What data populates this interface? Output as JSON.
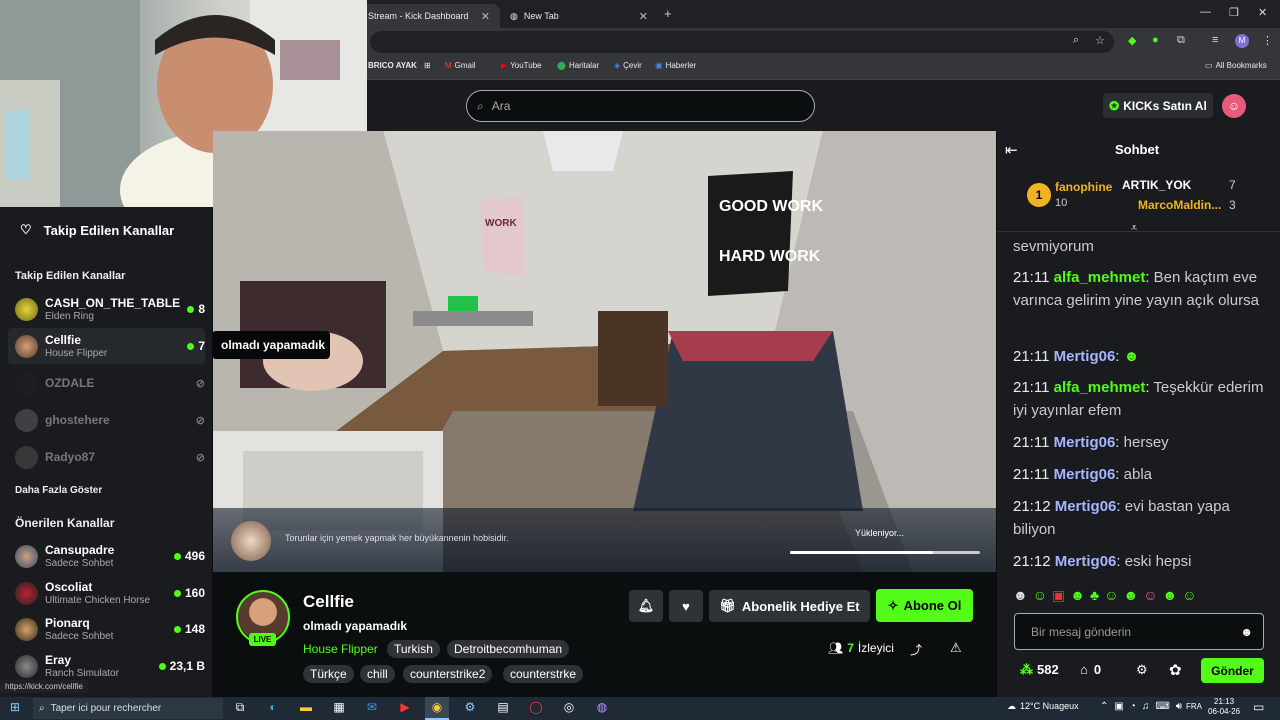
{
  "browser": {
    "tabs": [
      {
        "label": "Stream - Kick Dashboard"
      },
      {
        "label": "New Tab"
      }
    ],
    "bookmarks": [
      {
        "label": "BRICO AYAK"
      },
      {
        "label": "Gmail"
      },
      {
        "label": "YouTube"
      },
      {
        "label": "Haritalar"
      },
      {
        "label": "Çevir"
      },
      {
        "label": "Haberler"
      }
    ],
    "all_bookmarks": "All Bookmarks",
    "profile_initial": "M",
    "status_url": "https://kick.com/cellfie"
  },
  "header": {
    "search_placeholder": "Ara",
    "kicks_button": "KICKs Satın Al"
  },
  "sidebar": {
    "title": "Takip Edilen Kanallar",
    "followed_heading": "Takip Edilen Kanallar",
    "followed": [
      {
        "name": "CASH_ON_THE_TABLE",
        "game": "Elden Ring",
        "viewers": "8",
        "live": true
      },
      {
        "name": "Cellfie",
        "game": "House Flipper",
        "viewers": "7",
        "live": true
      },
      {
        "name": "OZDALE",
        "game": "",
        "viewers": "",
        "live": false
      },
      {
        "name": "ghostehere",
        "game": "",
        "viewers": "",
        "live": false
      },
      {
        "name": "Radyo87",
        "game": "",
        "viewers": "",
        "live": false
      }
    ],
    "show_more": "Daha Fazla Göster",
    "recommended_heading": "Önerilen Kanallar",
    "recommended": [
      {
        "name": "Cansupadre",
        "game": "Sadece Sohbet",
        "viewers": "496"
      },
      {
        "name": "Oscoliat",
        "game": "Ultimate Chicken Horse",
        "viewers": "160"
      },
      {
        "name": "Pionarq",
        "game": "Sadece Sohbet",
        "viewers": "148"
      },
      {
        "name": "Eray",
        "game": "Ranch Simulator",
        "viewers": "23,1 B"
      }
    ],
    "tooltip": "olmadı yapamadık"
  },
  "video": {
    "poster_top": "GOOD WORK",
    "poster_bottom": "HARD WORK",
    "poster_left": "WORK",
    "loading_tip": "Torunlar için yemek yapmak her büyükannenin hobisidir.",
    "loading_label": "Yükleniyor...",
    "loading_progress": 0.75
  },
  "stream_info": {
    "channel": "Cellfie",
    "live_badge": "LIVE",
    "title": "olmadı yapamadık",
    "category": "House Flipper",
    "tags_row1": [
      "Turkish",
      "Detroitbecomhuman"
    ],
    "tags_row2": [
      "Türkçe",
      "chill",
      "counterstrike2",
      "counterstrke"
    ],
    "gift_sub": "Abonelik Hediye Et",
    "subscribe": "Abone Ol",
    "viewer_count": "7",
    "viewer_label": "İzleyici"
  },
  "chat": {
    "title": "Sohbet",
    "gifters": [
      {
        "name": "fanophine",
        "count": "10",
        "rank": "1"
      },
      {
        "name": "ARTIK_YOK",
        "count": "7"
      },
      {
        "name": "MarcoMaldin...",
        "count": "3"
      }
    ],
    "messages": [
      {
        "time": "",
        "user": "",
        "text": "sevmiyorum",
        "color": "u1"
      },
      {
        "time": "21:11",
        "user": "alfa_mehmet",
        "text": "Ben kaçtım eve varınca gelirim yine yayın açık olursa",
        "color": "u1"
      },
      {
        "time": "21:11",
        "user": "Mertig06",
        "text": "",
        "color": "u2"
      },
      {
        "time": "21:11",
        "user": "alfa_mehmet",
        "text": "Teşekkür ederim iyi yayınlar efem",
        "color": "u1"
      },
      {
        "time": "21:11",
        "user": "Mertig06",
        "text": "hersey",
        "color": "u2"
      },
      {
        "time": "21:11",
        "user": "Mertig06",
        "text": "abla",
        "color": "u2"
      },
      {
        "time": "21:12",
        "user": "Mertig06",
        "text": "evi bastan yapa biliyon",
        "color": "u2"
      },
      {
        "time": "21:12",
        "user": "Mertig06",
        "text": "eski hepsi",
        "color": "u2"
      }
    ],
    "input_placeholder": "Bir mesaj gönderin",
    "points": "582",
    "gifts": "0",
    "send": "Gönder"
  },
  "taskbar": {
    "search_placeholder": "Taper ici pour rechercher",
    "weather": "12°C  Nuageux",
    "lang": "FRA",
    "time": "21:13",
    "date": "06-04-26"
  },
  "colors": {
    "accent": "#53fc18",
    "bg": "#0b0e0f",
    "panel": "#191b1f"
  }
}
